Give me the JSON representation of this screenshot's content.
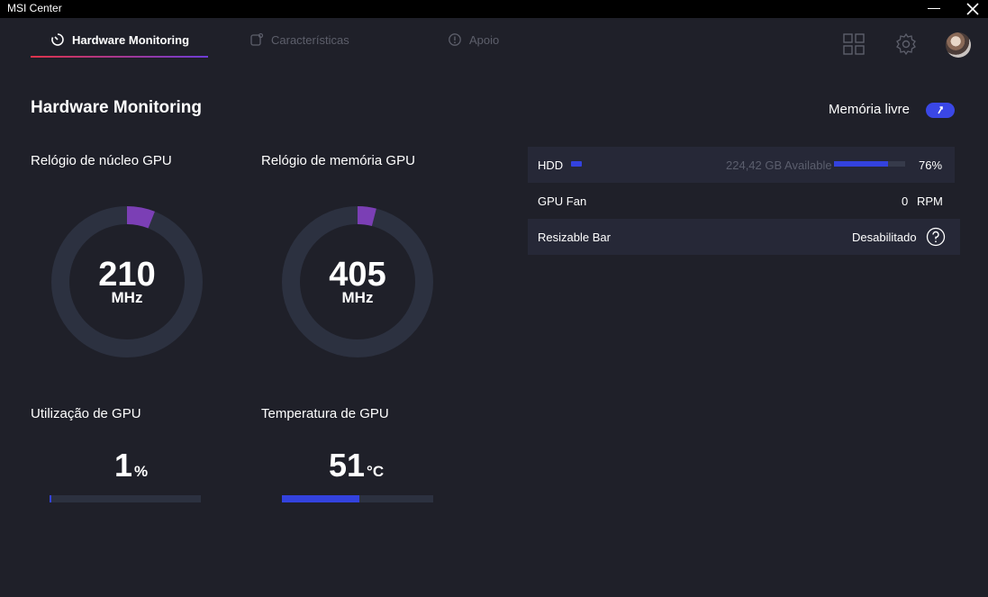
{
  "window": {
    "title": "MSI Center"
  },
  "nav": {
    "tabs": [
      {
        "label": "Hardware Monitoring",
        "active": true,
        "icon": "gauge-icon"
      },
      {
        "label": "Características",
        "active": false,
        "icon": "features-icon"
      },
      {
        "label": "Apoio",
        "active": false,
        "icon": "support-icon"
      }
    ]
  },
  "page": {
    "title": "Hardware Monitoring"
  },
  "free_memory": {
    "label": "Memória livre"
  },
  "gauges": [
    {
      "label": "Relógio de núcleo GPU",
      "value": "210",
      "unit": "MHz",
      "fraction": 0.06
    },
    {
      "label": "Relógio de memória GPU",
      "value": "405",
      "unit": "MHz",
      "fraction": 0.04
    }
  ],
  "meters": [
    {
      "label": "Utilização de GPU",
      "value": "1",
      "unit": "%",
      "fraction": 0.01
    },
    {
      "label": "Temperatura de GPU",
      "value": "51",
      "unit": "°C",
      "fraction": 0.51
    }
  ],
  "info": {
    "hdd": {
      "label": "HDD",
      "available": "224,42 GB Available",
      "percent": "76%",
      "fraction": 0.76
    },
    "gpu_fan": {
      "label": "GPU Fan",
      "value": "0",
      "unit": "RPM"
    },
    "resizable_bar": {
      "label": "Resizable Bar",
      "value": "Desabilitado"
    }
  },
  "colors": {
    "accent": "#3342de",
    "gauge_arc": "#7b3fb5",
    "track": "#2c3140",
    "background": "#1f2029"
  }
}
